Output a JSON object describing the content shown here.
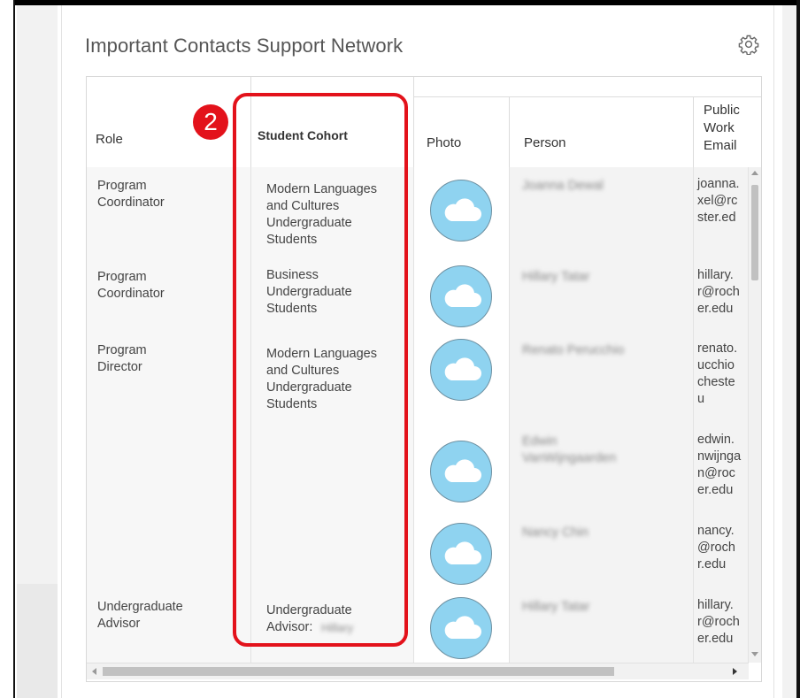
{
  "card": {
    "title": "Important Contacts Support Network"
  },
  "table": {
    "headers": {
      "role": "Role",
      "cohort": "Student Cohort",
      "photo": "Photo",
      "person": "Person",
      "email": "Public\nWork\nEmail"
    },
    "rows": [
      {
        "role": "Program\nCoordinator",
        "cohort": "Modern Languages\nand Cultures\nUndergraduate\nStudents",
        "person": "Joanna Dewal",
        "email": "joanna.\nxel@rc\nster.ed"
      },
      {
        "role": "Program\nCoordinator",
        "cohort": "Business\nUndergraduate\nStudents",
        "person": "Hillary Tatar",
        "email": "hillary.\nr@roch\ner.edu"
      },
      {
        "role": "Program\nDirector",
        "cohort": "Modern Languages\nand Cultures\nUndergraduate\nStudents",
        "person": "Renato Perucchio",
        "email": "renato.\nucchio\ncheste\nu"
      },
      {
        "role": "",
        "cohort": "",
        "person": "Edwin\nVanWijngaarden",
        "email": "edwin.\nnwijnga\nn@roc\ner.edu"
      },
      {
        "role": "",
        "cohort": "",
        "person": "Nancy Chin",
        "email": "nancy.\n@roch\nr.edu"
      },
      {
        "role": "Undergraduate\nAdvisor",
        "cohort": "Undergraduate\nAdvisor:",
        "cohort_blur": "Hillary",
        "person": "Hillary Tatar",
        "email": "hillary.\nr@roch\ner.edu"
      }
    ]
  },
  "annotation": {
    "step_number": "2",
    "color": "#e3121b"
  },
  "colors": {
    "avatar_fill": "#8fd3f0",
    "header_text": "#333333",
    "title_text": "#555555"
  }
}
